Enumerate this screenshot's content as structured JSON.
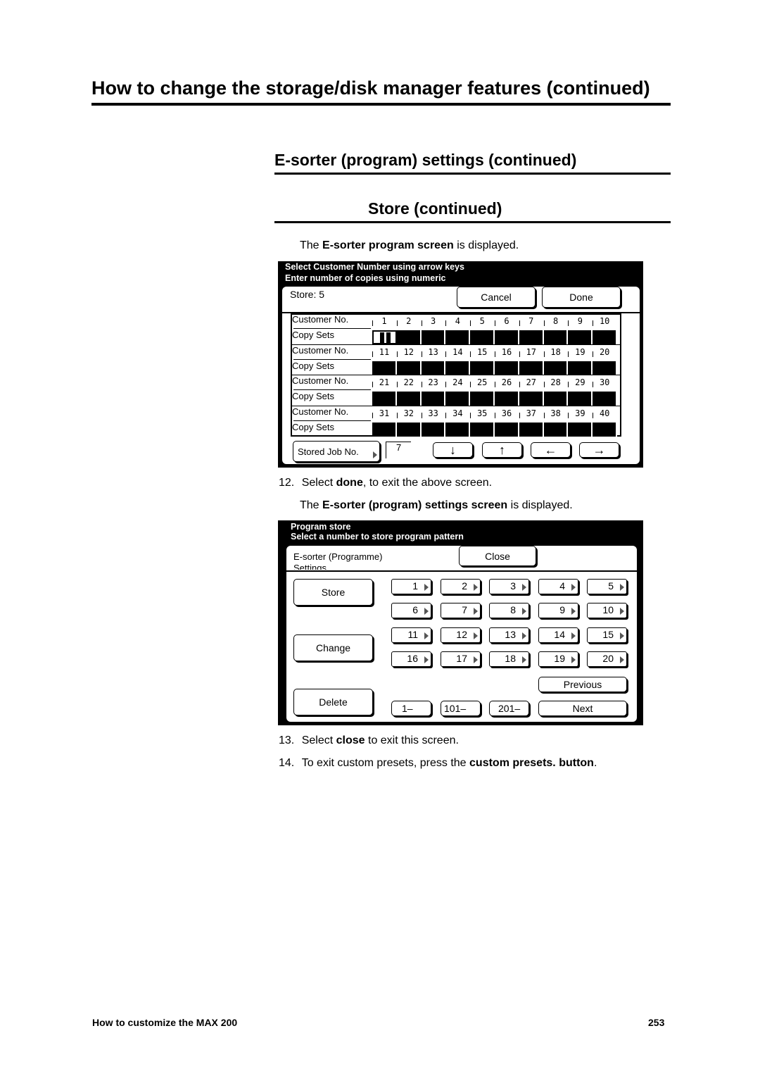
{
  "title": "How to change the storage/disk manager features (continued)",
  "section": "E-sorter (program) settings (continued)",
  "subsection": "Store (continued)",
  "intro": {
    "pre": "The ",
    "bold": "E-sorter program screen",
    "post": " is displayed."
  },
  "screen1": {
    "header1": "Select Customer Number using arrow keys",
    "header2": "Enter number of copies using numeric",
    "store_label": "Store:  5",
    "cancel": "Cancel",
    "done": "Done",
    "customer_label": "Customer No.",
    "copy_label": "Copy Sets",
    "rows": [
      [
        "1",
        "2",
        "3",
        "4",
        "5",
        "6",
        "7",
        "8",
        "9",
        "10"
      ],
      [
        "11",
        "12",
        "13",
        "14",
        "15",
        "16",
        "17",
        "18",
        "19",
        "20"
      ],
      [
        "21",
        "22",
        "23",
        "24",
        "25",
        "26",
        "27",
        "28",
        "29",
        "30"
      ],
      [
        "31",
        "32",
        "33",
        "34",
        "35",
        "36",
        "37",
        "38",
        "39",
        "40"
      ]
    ],
    "stored_job_label": "Stored Job No.",
    "stored_job_value": "7",
    "arrows": [
      "arrow-down",
      "arrow-up",
      "arrow-left",
      "arrow-right"
    ]
  },
  "step12": {
    "num": "12.",
    "pre": "Select ",
    "bold": "done",
    "post": ", to exit the above screen."
  },
  "step12b": {
    "pre": "The ",
    "bold": "E-sorter (program) settings screen",
    "post": " is displayed."
  },
  "screen2": {
    "header1": "Program store",
    "header2": "Select a number to store program pattern",
    "title": "E-sorter (Programme)",
    "title2": "Settings",
    "close": "Close",
    "store": "Store",
    "change": "Change",
    "delete": "Delete",
    "numbers": [
      "1",
      "2",
      "3",
      "4",
      "5",
      "6",
      "7",
      "8",
      "9",
      "10",
      "11",
      "12",
      "13",
      "14",
      "15",
      "16",
      "17",
      "18",
      "19",
      "20"
    ],
    "ranges": [
      "1–",
      "101–",
      "201–"
    ],
    "previous": "Previous",
    "next": "Next"
  },
  "step13": {
    "num": "13.",
    "pre": "Select ",
    "bold": "close",
    "post": " to exit this screen."
  },
  "step14": {
    "num": "14.",
    "pre": "To exit custom presets, press the ",
    "bold": "custom presets.  button",
    "post": "."
  },
  "footer": {
    "left": "How to customize the MAX 200",
    "page": "253"
  }
}
